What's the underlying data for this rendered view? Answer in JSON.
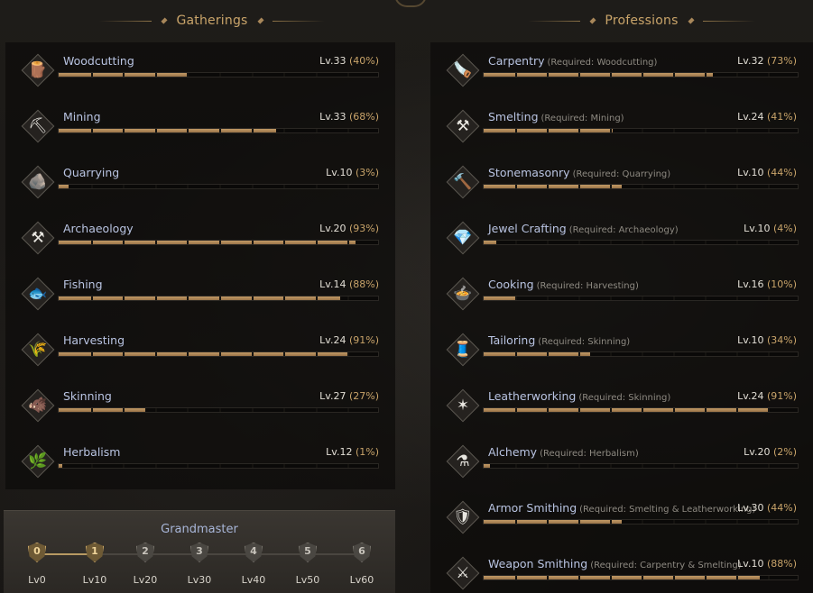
{
  "gatherings": {
    "title": "Gatherings",
    "items": [
      {
        "name": "Woodcutting",
        "level": "Lv.33",
        "pct": "(40%)",
        "progress": 0.4,
        "icon": "log-icon",
        "glyph": "🪵"
      },
      {
        "name": "Mining",
        "level": "Lv.33",
        "pct": "(68%)",
        "progress": 0.68,
        "icon": "pickaxe-icon",
        "glyph": "⛏"
      },
      {
        "name": "Quarrying",
        "level": "Lv.10",
        "pct": "(3%)",
        "progress": 0.03,
        "icon": "stone-icon",
        "glyph": "🪨"
      },
      {
        "name": "Archaeology",
        "level": "Lv.20",
        "pct": "(93%)",
        "progress": 0.93,
        "icon": "shovel-icon",
        "glyph": "⚒"
      },
      {
        "name": "Fishing",
        "level": "Lv.14",
        "pct": "(88%)",
        "progress": 0.88,
        "icon": "fish-icon",
        "glyph": "🐟"
      },
      {
        "name": "Harvesting",
        "level": "Lv.24",
        "pct": "(91%)",
        "progress": 0.91,
        "icon": "sickle-icon",
        "glyph": "🌾"
      },
      {
        "name": "Skinning",
        "level": "Lv.27",
        "pct": "(27%)",
        "progress": 0.27,
        "icon": "boar-icon",
        "glyph": "🐗"
      },
      {
        "name": "Herbalism",
        "level": "Lv.12",
        "pct": "(1%)",
        "progress": 0.01,
        "icon": "herb-icon",
        "glyph": "🌿"
      }
    ]
  },
  "professions": {
    "title": "Professions",
    "items": [
      {
        "name": "Carpentry",
        "req": "(Required: Woodcutting)",
        "level": "Lv.32",
        "pct": "(73%)",
        "progress": 0.73,
        "icon": "saw-icon",
        "glyph": "🪚"
      },
      {
        "name": "Smelting",
        "req": "(Required: Mining)",
        "level": "Lv.24",
        "pct": "(41%)",
        "progress": 0.41,
        "icon": "anvil-icon",
        "glyph": "⚒"
      },
      {
        "name": "Stonemasonry",
        "req": "(Required: Quarrying)",
        "level": "Lv.10",
        "pct": "(44%)",
        "progress": 0.44,
        "icon": "hammer-icon",
        "glyph": "🔨"
      },
      {
        "name": "Jewel Crafting",
        "req": "(Required: Archaeology)",
        "level": "Lv.10",
        "pct": "(4%)",
        "progress": 0.04,
        "icon": "gem-icon",
        "glyph": "💎"
      },
      {
        "name": "Cooking",
        "req": "(Required: Harvesting)",
        "level": "Lv.16",
        "pct": "(10%)",
        "progress": 0.1,
        "icon": "pot-icon",
        "glyph": "🍲"
      },
      {
        "name": "Tailoring",
        "req": "(Required: Skinning)",
        "level": "Lv.10",
        "pct": "(34%)",
        "progress": 0.34,
        "icon": "needle-icon",
        "glyph": "🧵"
      },
      {
        "name": "Leatherworking",
        "req": "(Required: Skinning)",
        "level": "Lv.24",
        "pct": "(91%)",
        "progress": 0.91,
        "icon": "leather-icon",
        "glyph": "✶"
      },
      {
        "name": "Alchemy",
        "req": "(Required: Herbalism)",
        "level": "Lv.20",
        "pct": "(2%)",
        "progress": 0.02,
        "icon": "flask-icon",
        "glyph": "⚗"
      },
      {
        "name": "Armor Smithing",
        "req": "(Required: Smelting & Leatherworking)",
        "level": "Lv.30",
        "pct": "(44%)",
        "progress": 0.44,
        "icon": "armor-icon",
        "glyph": "🛡"
      },
      {
        "name": "Weapon Smithing",
        "req": "(Required: Carpentry & Smelting)",
        "level": "Lv.10",
        "pct": "(88%)",
        "progress": 0.88,
        "icon": "sword-icon",
        "glyph": "⚔"
      }
    ]
  },
  "grandmaster": {
    "title": "Grandmaster",
    "current_rank": 1,
    "ranks": [
      {
        "num": "0",
        "label": "Lv0",
        "active": true
      },
      {
        "num": "1",
        "label": "Lv10",
        "active": true
      },
      {
        "num": "2",
        "label": "Lv20",
        "active": false
      },
      {
        "num": "3",
        "label": "Lv30",
        "active": false
      },
      {
        "num": "4",
        "label": "Lv40",
        "active": false
      },
      {
        "num": "5",
        "label": "Lv50",
        "active": false
      },
      {
        "num": "6",
        "label": "Lv60",
        "active": false
      }
    ]
  }
}
